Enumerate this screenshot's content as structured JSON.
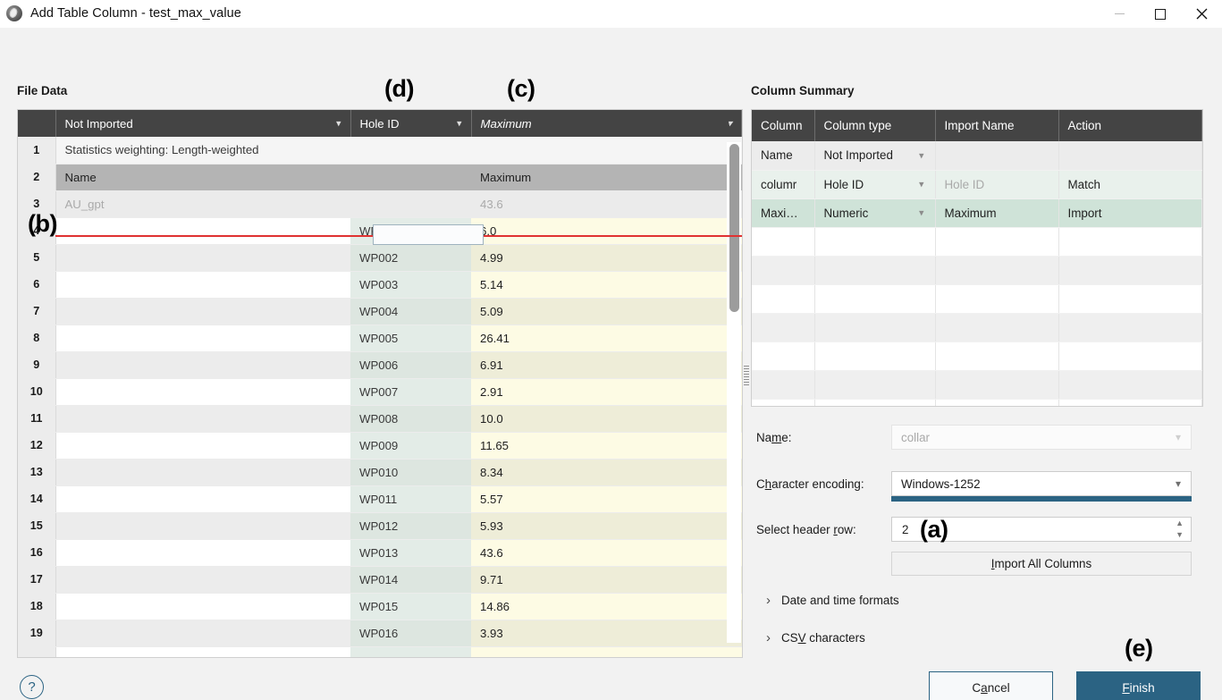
{
  "window": {
    "title": "Add Table Column - test_max_value",
    "minimize": "minimize",
    "maximize": "maximize",
    "close": "close"
  },
  "file_data": {
    "label": "File Data",
    "headers": [
      {
        "text": "",
        "caret": false
      },
      {
        "text": "Not Imported",
        "caret": true,
        "italic": false
      },
      {
        "text": "Hole ID",
        "caret": true,
        "italic": false
      },
      {
        "text": "Maximum",
        "caret": true,
        "italic": true
      }
    ],
    "rows": [
      {
        "num": "1",
        "c1": "Statistics weighting: Length-weighted",
        "c2": "",
        "c3": "",
        "style": "strike"
      },
      {
        "num": "2",
        "c1": "Name",
        "c2": "",
        "c3": "Maximum",
        "style": "header2"
      },
      {
        "num": "3",
        "c1": "AU_gpt",
        "c2": "",
        "c3": "43.6",
        "style": "grey"
      },
      {
        "num": "4",
        "c1": "",
        "c2": "WP001",
        "c3": "6.0",
        "style": "odd"
      },
      {
        "num": "5",
        "c1": "",
        "c2": "WP002",
        "c3": "4.99",
        "style": "even"
      },
      {
        "num": "6",
        "c1": "",
        "c2": "WP003",
        "c3": "5.14",
        "style": "odd"
      },
      {
        "num": "7",
        "c1": "",
        "c2": "WP004",
        "c3": "5.09",
        "style": "even"
      },
      {
        "num": "8",
        "c1": "",
        "c2": "WP005",
        "c3": "26.41",
        "style": "odd"
      },
      {
        "num": "9",
        "c1": "",
        "c2": "WP006",
        "c3": "6.91",
        "style": "even"
      },
      {
        "num": "10",
        "c1": "",
        "c2": "WP007",
        "c3": "2.91",
        "style": "odd"
      },
      {
        "num": "11",
        "c1": "",
        "c2": "WP008",
        "c3": "10.0",
        "style": "even"
      },
      {
        "num": "12",
        "c1": "",
        "c2": "WP009",
        "c3": "11.65",
        "style": "odd"
      },
      {
        "num": "13",
        "c1": "",
        "c2": "WP010",
        "c3": "8.34",
        "style": "even"
      },
      {
        "num": "14",
        "c1": "",
        "c2": "WP011",
        "c3": "5.57",
        "style": "odd"
      },
      {
        "num": "15",
        "c1": "",
        "c2": "WP012",
        "c3": "5.93",
        "style": "even"
      },
      {
        "num": "16",
        "c1": "",
        "c2": "WP013",
        "c3": "43.6",
        "style": "odd"
      },
      {
        "num": "17",
        "c1": "",
        "c2": "WP014",
        "c3": "9.71",
        "style": "even"
      },
      {
        "num": "18",
        "c1": "",
        "c2": "WP015",
        "c3": "14.86",
        "style": "odd"
      },
      {
        "num": "19",
        "c1": "",
        "c2": "WP016",
        "c3": "3.93",
        "style": "even"
      },
      {
        "num": "",
        "c1": "",
        "c2": "",
        "c3": "",
        "style": "odd"
      }
    ]
  },
  "column_summary": {
    "label": "Column Summary",
    "headers": [
      "Column",
      "Column type",
      "Import Name",
      "Action"
    ],
    "rows": [
      {
        "column": "Name",
        "type": "Not Imported",
        "import_name": "",
        "import_name_muted": false,
        "action": ""
      },
      {
        "column": "columr",
        "type": "Hole ID",
        "import_name": "Hole ID",
        "import_name_muted": true,
        "action": "Match"
      },
      {
        "column": "Maxi…",
        "type": "Numeric",
        "import_name": "Maximum",
        "import_name_muted": false,
        "action": "Import"
      }
    ],
    "blank_row_count": 7
  },
  "form": {
    "name_label": "Name:",
    "name_label_parts": [
      "Na",
      "m",
      "e:"
    ],
    "name_value": "collar",
    "encoding_label": "Character encoding:",
    "encoding_label_parts": [
      "C",
      "h",
      "aracter encoding:"
    ],
    "encoding_value": "Windows-1252",
    "header_row_label": "Select header row:",
    "header_row_label_parts": [
      "Select header ",
      "r",
      "ow:"
    ],
    "header_row_value": "2",
    "import_all_label": "Import All Columns",
    "import_all_parts": [
      "I",
      "mport All Columns"
    ],
    "disclosures": [
      {
        "label": "Date and time formats"
      },
      {
        "label": "CSV characters",
        "parts": [
          "CS",
          "V",
          " characters"
        ]
      }
    ]
  },
  "footer": {
    "help": "?",
    "cancel_label": "Cancel",
    "cancel_parts": [
      "C",
      "a",
      "ncel"
    ],
    "finish_label": "Finish",
    "finish_parts": [
      "F",
      "inish"
    ]
  },
  "annotations": {
    "a": "(a)",
    "b": "(b)",
    "c": "(c)",
    "d": "(d)",
    "e": "(e)"
  },
  "colors": {
    "accent": "#2b6383",
    "header_bg": "#444444",
    "warning_line": "#e03232",
    "highlight_green": "#cfe3d8",
    "highlight_yellow": "#fdfbe4"
  }
}
